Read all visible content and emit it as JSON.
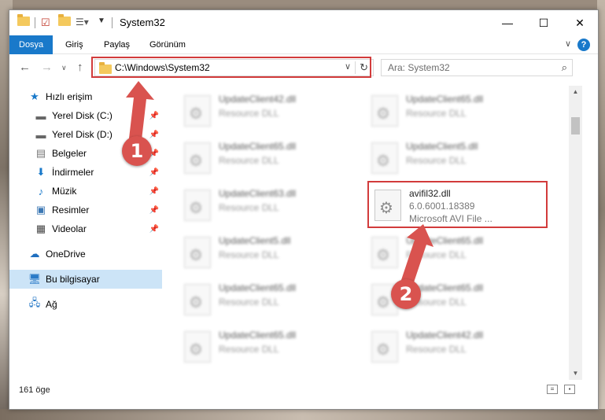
{
  "window": {
    "title": "System32",
    "controls": {
      "minimize": "—",
      "maximize": "☐",
      "close": "✕"
    }
  },
  "ribbon": {
    "tabs": [
      {
        "label": "Dosya",
        "active": true
      },
      {
        "label": "Giriş"
      },
      {
        "label": "Paylaş"
      },
      {
        "label": "Görünüm"
      }
    ],
    "help": "?"
  },
  "address": {
    "path": "C:\\Windows\\System32"
  },
  "search": {
    "placeholder": "Ara: System32"
  },
  "sidebar": {
    "items": [
      {
        "label": "Hızlı erişim",
        "icon": "star-icon"
      },
      {
        "label": "Yerel Disk (C:)",
        "icon": "drive-icon",
        "pinned": true
      },
      {
        "label": "Yerel Disk (D:)",
        "icon": "drive-icon",
        "pinned": true
      },
      {
        "label": "Belgeler",
        "icon": "document-icon",
        "pinned": true
      },
      {
        "label": "İndirmeler",
        "icon": "download-icon",
        "pinned": true
      },
      {
        "label": "Müzik",
        "icon": "music-icon",
        "pinned": true
      },
      {
        "label": "Resimler",
        "icon": "picture-icon",
        "pinned": true
      },
      {
        "label": "Videolar",
        "icon": "video-icon",
        "pinned": true
      },
      {
        "label": "OneDrive",
        "icon": "cloud-icon"
      },
      {
        "label": "Bu bilgisayar",
        "icon": "computer-icon",
        "selected": true
      },
      {
        "label": "Ağ",
        "icon": "network-icon"
      }
    ]
  },
  "files": {
    "left": [
      {
        "name": "UpdateClient42.dll",
        "type": "Resource DLL"
      },
      {
        "name": "UpdateClient65.dll",
        "type": "Resource DLL"
      },
      {
        "name": "UpdateClient63.dll",
        "type": "Resource DLL"
      },
      {
        "name": "UpdateClient5.dll",
        "type": "Resource DLL"
      },
      {
        "name": "UpdateClient65.dll",
        "type": "Resource DLL"
      },
      {
        "name": "UpdateClient65.dll",
        "type": "Resource DLL"
      }
    ],
    "right": [
      {
        "name": "UpdateClient65.dll",
        "type": "Resource DLL"
      },
      {
        "name": "UpdateClient5.dll",
        "type": "Resource DLL"
      },
      {
        "name": "avifil32.dll",
        "version": "6.0.6001.18389",
        "type": "Microsoft AVI File ...",
        "focus": true
      },
      {
        "name": "UpdateClient65.dll",
        "type": "Resource DLL"
      },
      {
        "name": "UpdateClient65.dll",
        "type": "Resource DLL"
      },
      {
        "name": "UpdateClient42.dll",
        "type": "Resource DLL"
      }
    ]
  },
  "status": {
    "count": "161 öge"
  },
  "annotations": {
    "step1": "1",
    "step2": "2"
  },
  "colors": {
    "accent": "#1979ca",
    "highlight": "#d23b3b",
    "step_badge": "#d9534f"
  }
}
